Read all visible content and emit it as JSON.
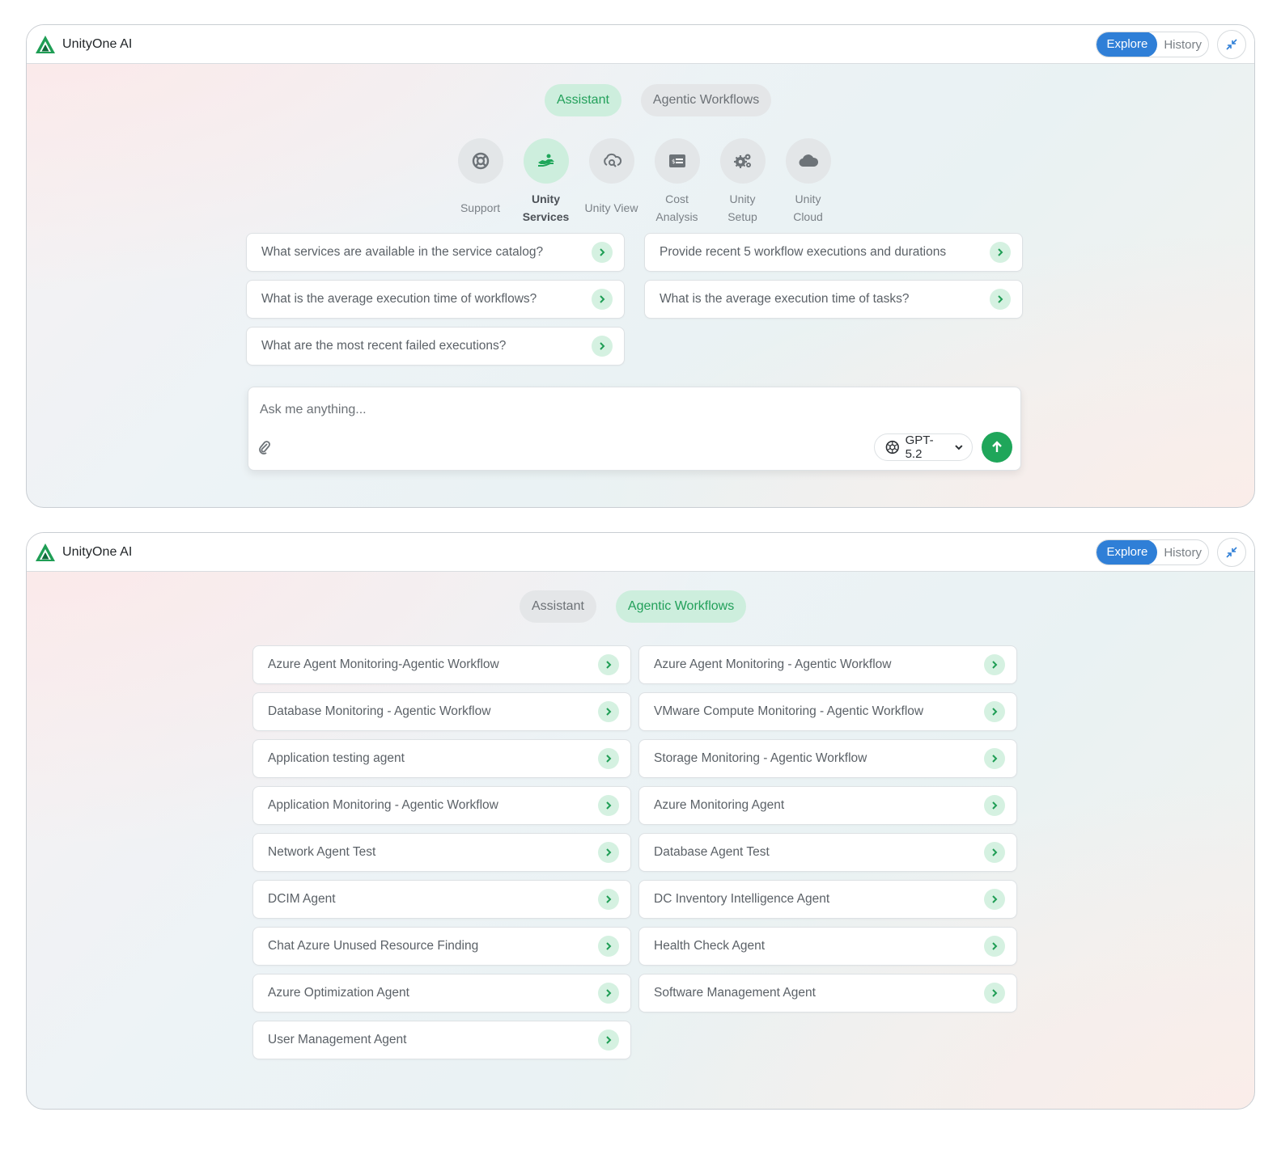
{
  "panel1": {
    "brand": "UnityOne AI",
    "explore": "Explore",
    "history": "History",
    "tabs": [
      "Assistant",
      "Agentic Workflows"
    ],
    "categories": [
      {
        "line1": "Support",
        "line2": "",
        "icon": "lifebuoy-icon"
      },
      {
        "line1": "Unity",
        "line2": "Services",
        "icon": "handshake-icon"
      },
      {
        "line1": "Unity View",
        "line2": "",
        "icon": "cloud-search-icon"
      },
      {
        "line1": "Cost",
        "line2": "Analysis",
        "icon": "billing-icon"
      },
      {
        "line1": "Unity",
        "line2": "Setup",
        "icon": "gears-icon"
      },
      {
        "line1": "Unity",
        "line2": "Cloud",
        "icon": "cloud-icon"
      }
    ],
    "suggestions": [
      "What services are available in the service catalog?",
      "Provide recent 5 workflow executions and durations",
      "What is the average execution time of workflows?",
      "What is the average execution time of tasks?",
      "What are the most recent failed executions?"
    ],
    "composer": {
      "placeholder": "Ask me anything...",
      "model": "GPT-5.2"
    }
  },
  "panel2": {
    "brand": "UnityOne AI",
    "explore": "Explore",
    "history": "History",
    "tabs": [
      "Assistant",
      "Agentic Workflows"
    ],
    "workflows": [
      "Azure Agent Monitoring-Agentic Workflow",
      "Azure Agent Monitoring - Agentic Workflow",
      "Database Monitoring - Agentic Workflow",
      "VMware Compute Monitoring - Agentic Workflow",
      "Application testing agent",
      "Storage Monitoring - Agentic Workflow",
      "Application Monitoring - Agentic Workflow",
      "Azure Monitoring Agent",
      "Network Agent Test",
      "Database Agent Test",
      "DCIM Agent",
      "DC Inventory Intelligence Agent",
      "Chat Azure Unused Resource Finding",
      "Health Check Agent",
      "Azure Optimization Agent",
      "Software Management Agent",
      "User Management Agent"
    ]
  },
  "colors": {
    "accent_green": "#1fa65a",
    "active_tab_bg": "#cdeedd",
    "explore_blue": "#2f7fd7"
  }
}
